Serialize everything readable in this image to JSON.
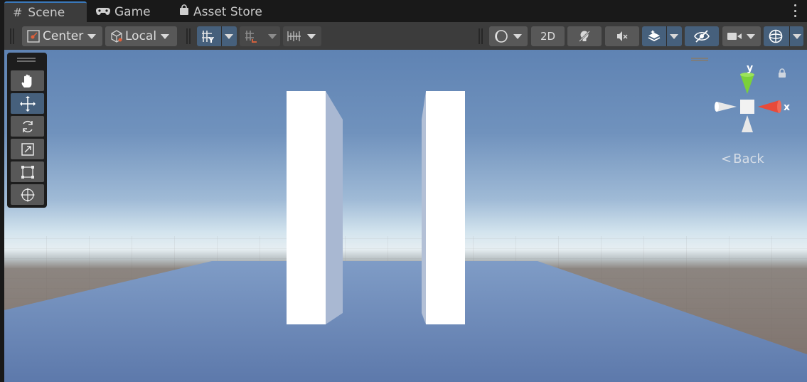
{
  "tabs": [
    {
      "label": "Scene",
      "icon": "hash-icon",
      "active": true
    },
    {
      "label": "Game",
      "icon": "gamepad-icon",
      "active": false
    },
    {
      "label": "Asset Store",
      "icon": "shopping-bag-icon",
      "active": false
    }
  ],
  "toolbar": {
    "pivot_mode": "Center",
    "pivot_rotation": "Local",
    "mode_2d": "2D"
  },
  "gizmo": {
    "y_label": "y",
    "x_label": "x",
    "back_label": "Back"
  },
  "colors": {
    "accent": "#3a79bb",
    "active_button": "#46607c",
    "gizmo_x": "#e84a3a",
    "gizmo_y": "#7bd13a"
  }
}
